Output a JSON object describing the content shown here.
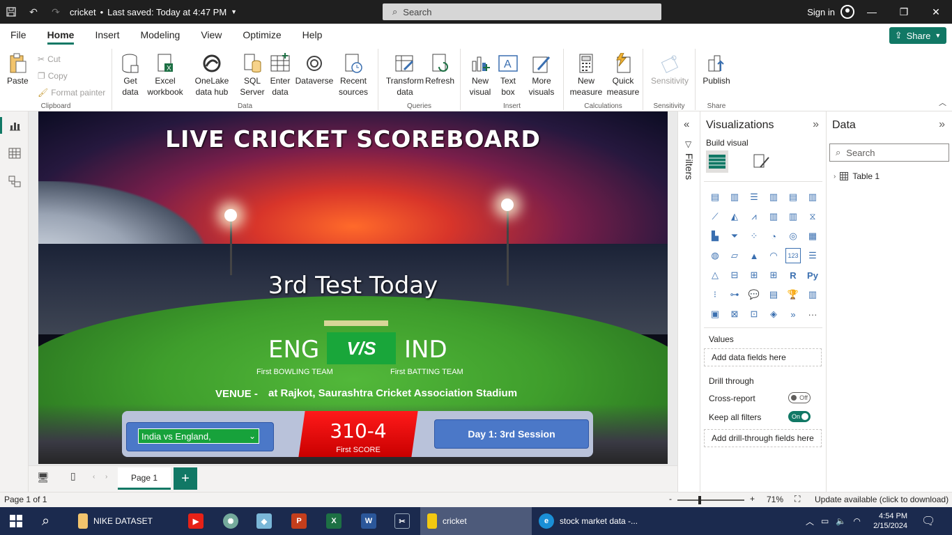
{
  "titlebar": {
    "file_name": "cricket",
    "saved_status": "Last saved: Today at 4:47 PM",
    "search_placeholder": "Search",
    "sign_in": "Sign in"
  },
  "menu": {
    "items": [
      "File",
      "Home",
      "Insert",
      "Modeling",
      "View",
      "Optimize",
      "Help"
    ],
    "active": "Home",
    "share_label": "Share"
  },
  "ribbon": {
    "clipboard": {
      "paste": "Paste",
      "cut": "Cut",
      "copy": "Copy",
      "format_painter": "Format painter",
      "label": "Clipboard"
    },
    "data": {
      "get_data": "Get data",
      "excel": "Excel workbook",
      "onelake": "OneLake data hub",
      "sql": "SQL Server",
      "enter_data": "Enter data",
      "dataverse": "Dataverse",
      "recent": "Recent sources",
      "label": "Data"
    },
    "queries": {
      "transform": "Transform data",
      "refresh": "Refresh",
      "label": "Queries"
    },
    "insert": {
      "new_visual": "New visual",
      "text_box": "Text box",
      "more_visuals": "More visuals",
      "label": "Insert"
    },
    "calculations": {
      "new_measure": "New measure",
      "quick_measure": "Quick measure",
      "label": "Calculations"
    },
    "sensitivity": {
      "sensitivity": "Sensitivity",
      "label": "Sensitivity"
    },
    "share": {
      "publish": "Publish",
      "label": "Share"
    }
  },
  "report": {
    "title": "LIVE CRICKET SCOREBOARD",
    "subtitle": "3rd Test  Today",
    "team_left": "ENG",
    "vs": "V/S",
    "team_right": "IND",
    "role_left": "First BOWLING TEAM",
    "role_right": "First BATTING TEAM",
    "venue_label": "VENUE -",
    "venue": "at Rajkot, Saurashtra Cricket Association Stadium",
    "match_select": "India vs England,",
    "score": "310-4",
    "score_label": "First SCORE",
    "session": "Day 1: 3rd Session"
  },
  "filters": {
    "label": "Filters"
  },
  "visualizations": {
    "title": "Visualizations",
    "build_visual": "Build visual",
    "values_label": "Values",
    "values_placeholder": "Add data fields here",
    "drill_through": "Drill through",
    "cross_report": "Cross-report",
    "cross_report_state": "Off",
    "keep_filters": "Keep all filters",
    "keep_filters_state": "On",
    "drill_placeholder": "Add drill-through fields here"
  },
  "data_pane": {
    "title": "Data",
    "search_placeholder": "Search",
    "tables": [
      "Table 1"
    ]
  },
  "pages": {
    "tabs": [
      "Page 1"
    ],
    "add": "+"
  },
  "status": {
    "page_info": "Page 1 of 1",
    "zoom_minus": "-",
    "zoom_plus": "+",
    "zoom": "71%",
    "update": "Update available (click to download)"
  },
  "taskbar": {
    "apps": [
      "NIKE DATASET",
      "cricket",
      "stock market data -..."
    ],
    "time": "4:54 PM",
    "date": "2/15/2024"
  }
}
